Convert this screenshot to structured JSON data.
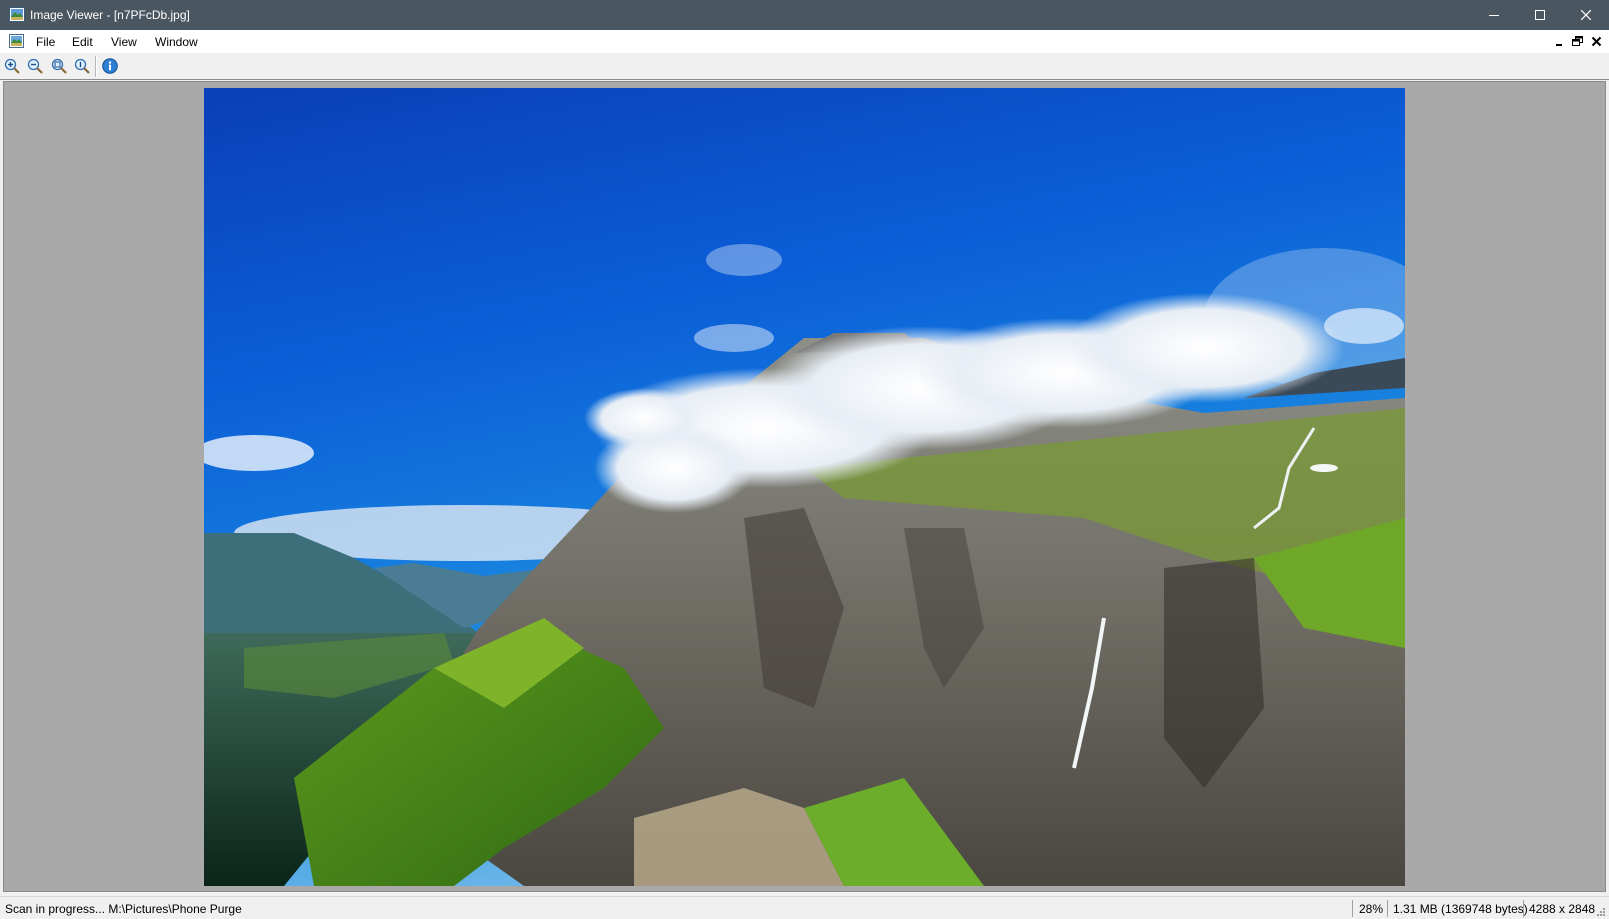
{
  "window": {
    "title": "Image Viewer - [n7PFcDb.jpg]",
    "title_bar_color": "#4a5660"
  },
  "menu": {
    "items": [
      {
        "label": "File"
      },
      {
        "label": "Edit"
      },
      {
        "label": "View"
      },
      {
        "label": "Window"
      }
    ]
  },
  "toolbar": {
    "buttons": [
      {
        "icon": "zoom-in-icon"
      },
      {
        "icon": "zoom-out-icon"
      },
      {
        "icon": "zoom-fit-icon"
      },
      {
        "icon": "zoom-actual-icon"
      },
      {
        "icon": "info-icon"
      }
    ]
  },
  "image": {
    "description_icon": "landscape-photo",
    "canvas_background": "#a9a9a9"
  },
  "status": {
    "message": "Scan in progress... M:\\Pictures\\Phone Purge",
    "zoom": "28%",
    "file_size": "1.31 MB (1369748 bytes)",
    "dimensions": "4288 x 2848"
  }
}
